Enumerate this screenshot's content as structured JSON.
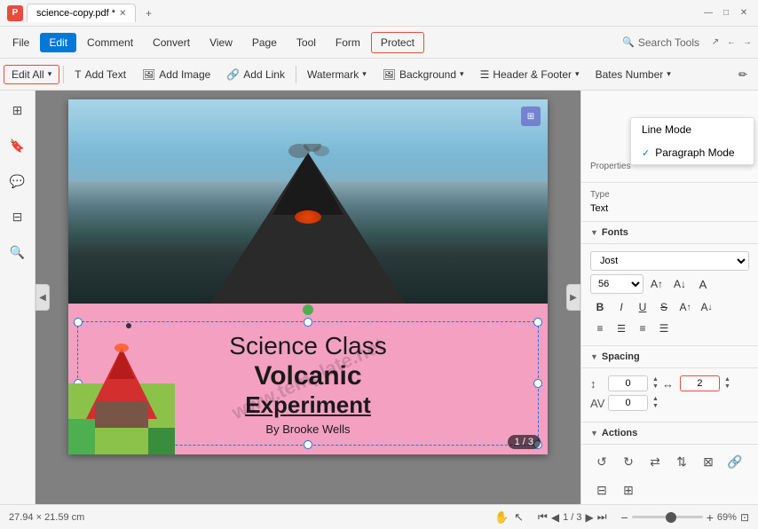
{
  "app": {
    "title": "science-copy.pdf *",
    "icon": "P"
  },
  "titleBar": {
    "filename": "science-copy.pdf *",
    "controls": [
      "minimize",
      "maximize",
      "close"
    ]
  },
  "menuBar": {
    "items": [
      "File",
      "Edit",
      "Comment",
      "Convert",
      "View",
      "Page",
      "Tool",
      "Form",
      "Protect"
    ],
    "activeItem": "Edit",
    "highlightedItem": "Edit",
    "searchPlaceholder": "Search Tools"
  },
  "toolbar": {
    "editAll": "Edit All",
    "addText": "Add Text",
    "addImage": "Add Image",
    "addLink": "Add Link",
    "watermark": "Watermark",
    "background": "Background",
    "headerFooter": "Header & Footer",
    "batesNumber": "Bates Number"
  },
  "modeDropdown": {
    "lineMode": "Line Mode",
    "paragraphMode": "Paragraph Mode",
    "checkedItem": "Paragraph Mode"
  },
  "rightPanel": {
    "propertiesLabel": "Properties",
    "typeLabel": "Type",
    "typeValue": "Text",
    "fonts": {
      "sectionLabel": "Fonts",
      "fontName": "Jost",
      "fontSize": "56",
      "formatButtons": [
        "B",
        "I",
        "U",
        "S",
        "A↑",
        "A↓"
      ],
      "alignButtons": [
        "≡left",
        "≡center",
        "≡right",
        "≡justify"
      ]
    },
    "spacing": {
      "sectionLabel": "Spacing",
      "lineSpacingValue": "0",
      "charSpacingValue": "2",
      "afterSpacingValue": "0"
    },
    "actions": {
      "sectionLabel": "Actions",
      "buttons": [
        "↺",
        "↻",
        "flip-h",
        "flip-v",
        "crop",
        "link",
        "align",
        "distribute",
        "more"
      ]
    }
  },
  "document": {
    "title1": "Science Class",
    "title2": "Volcanic",
    "title3": "Experiment",
    "author": "By Brooke Wells",
    "watermark": "www.template.net",
    "pageInfo": "1 / 3",
    "pageInfoNav": "1 / 3"
  },
  "statusBar": {
    "dimensions": "27.94 × 21.59 cm",
    "currentPage": "1 / 3",
    "zoomLevel": "69%",
    "zoomSliderPosition": 55
  }
}
